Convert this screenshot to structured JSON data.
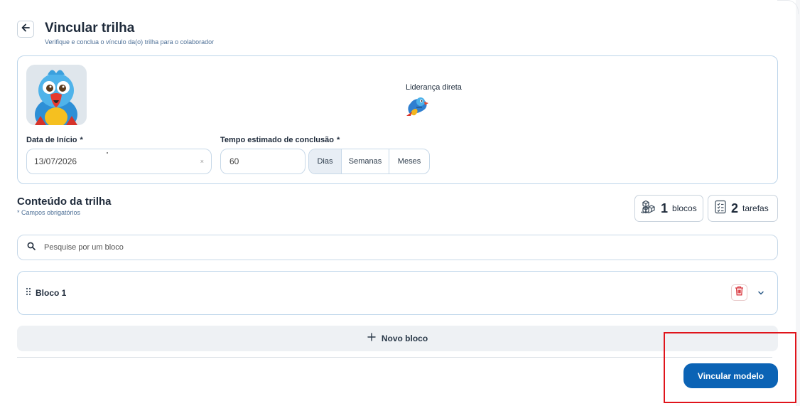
{
  "header": {
    "title": "Vincular trilha",
    "subtitle": "Verifique e conclua o vínculo da(o) trilha para o colaborador"
  },
  "leader": {
    "label": "Liderança direta"
  },
  "form": {
    "start_date": {
      "label": "Data de Início",
      "required_mark": "*",
      "value": "13/07/2026",
      "clear": "×"
    },
    "duration": {
      "label": "Tempo estimado de conclusão",
      "required_mark": "*",
      "value": "60",
      "units": [
        "Dias",
        "Semanas",
        "Meses"
      ],
      "selected_unit": "Dias"
    }
  },
  "content": {
    "title": "Conteúdo da trilha",
    "required_note": "* Campos obrigatórios",
    "blocks_count": "1",
    "blocks_label": "blocos",
    "tasks_count": "2",
    "tasks_label": "tarefas"
  },
  "search": {
    "placeholder": "Pesquise por um bloco"
  },
  "blocks": [
    {
      "title": "Bloco 1"
    }
  ],
  "actions": {
    "new_block": "Novo bloco",
    "submit": "Vincular modelo"
  },
  "colors": {
    "primary": "#0b63b5",
    "border": "#bdd5ea",
    "danger": "#d9373e",
    "highlight": "#e0141b"
  },
  "icons": [
    "arrow-left-icon",
    "cubes-icon",
    "checklist-icon",
    "search-icon",
    "drag-handle-icon",
    "trash-icon",
    "chevron-down-icon",
    "plus-icon"
  ]
}
